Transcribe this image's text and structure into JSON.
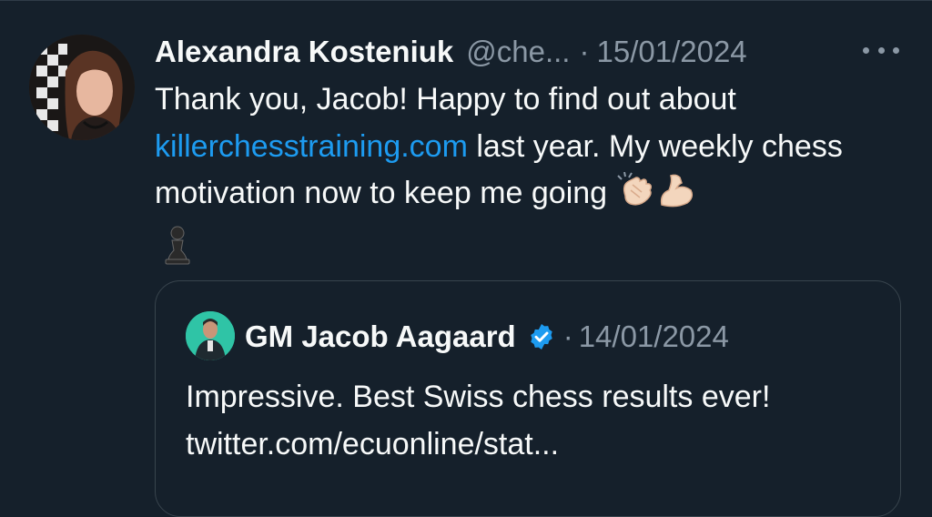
{
  "tweet": {
    "author_name": "Alexandra Kosteniuk",
    "handle": "@che...",
    "separator": "·",
    "date": "15/01/2024",
    "text_1": "Thank you, Jacob! Happy to find out about",
    "link": "killerchesstraining.com",
    "text_2": " last year. My weekly chess motivation now to keep me going ",
    "emojis": [
      "clapping-hands-icon",
      "flexed-biceps-icon",
      "chess-pawn-icon"
    ]
  },
  "quote": {
    "author_name": "GM Jacob Aagaard",
    "separator": "·",
    "date": "14/01/2024",
    "text": "Impressive. Best Swiss chess results ever! twitter.com/ecuonline/stat..."
  },
  "colors": {
    "background": "#15202b",
    "link": "#1d9bf0",
    "muted": "#8b98a5",
    "verified": "#1d9bf0",
    "border": "#38444d"
  }
}
